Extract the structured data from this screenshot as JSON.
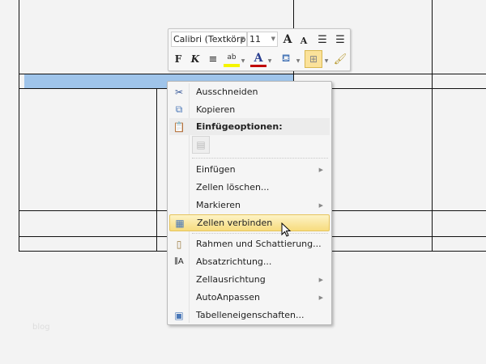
{
  "toolbar": {
    "font": "Calibri (Textkörp",
    "size": "11",
    "bold": "F",
    "italic": "K"
  },
  "menu": {
    "items": [
      {
        "label": "Ausschneiden",
        "icon": "scissors-icon"
      },
      {
        "label": "Kopieren",
        "icon": "copy-icon"
      },
      {
        "label": "Einfügeoptionen:",
        "icon": "paste-icon"
      },
      {
        "label": "Einfügen",
        "submenu": true
      },
      {
        "label": "Zellen löschen..."
      },
      {
        "label": "Markieren",
        "submenu": true
      },
      {
        "label": "Zellen verbinden",
        "icon": "merge-cells-icon"
      },
      {
        "label": "Rahmen und Schattierung...",
        "icon": "borders-icon"
      },
      {
        "label": "Absatzrichtung...",
        "icon": "text-direction-icon"
      },
      {
        "label": "Zellausrichtung",
        "submenu": true
      },
      {
        "label": "AutoAnpassen",
        "submenu": true
      },
      {
        "label": "Tabelleneigenschaften...",
        "icon": "table-properties-icon"
      }
    ]
  },
  "watermark": "blog",
  "colors": {
    "selection": "#9fc4ea",
    "highlight": "#f7dc7e"
  }
}
